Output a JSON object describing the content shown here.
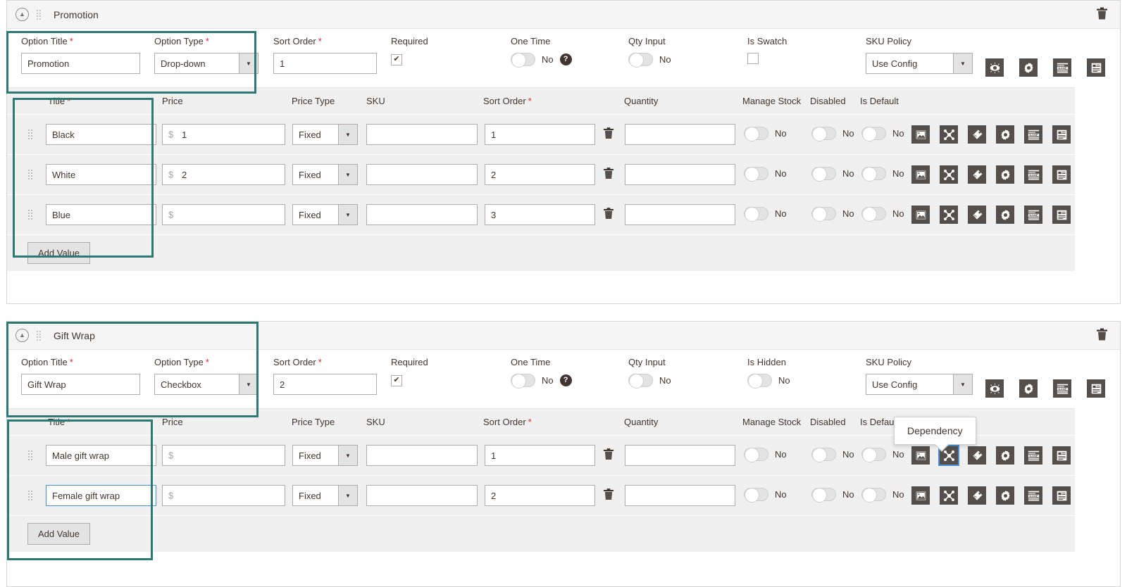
{
  "options": [
    {
      "header": {
        "title": "Promotion",
        "collapse_icon": "chevron-up-circle-icon",
        "drag_icon": "drag-handle-icon",
        "delete_icon": "trash-icon"
      },
      "meta": {
        "option_title_label": "Option Title",
        "option_title_value": "Promotion",
        "option_type_label": "Option Type",
        "option_type_value": "Drop-down",
        "sort_order_label": "Sort Order",
        "sort_order_value": "1",
        "required_label": "Required",
        "required_checked": "✔",
        "one_time_label": "One Time",
        "one_time_value": "No",
        "one_time_help_icon": "help-icon",
        "qty_input_label": "Qty Input",
        "qty_input_value": "No",
        "third_toggle_label": "Is Swatch",
        "third_toggle_kind": "checkbox",
        "third_toggle_value": "",
        "sku_policy_label": "SKU Policy",
        "sku_policy_value": "Use Config",
        "action_icons": [
          "preview-icon",
          "gear-icon",
          "name-icon",
          "list-icon"
        ]
      },
      "table": {
        "columns": [
          "Title",
          "Price",
          "Price Type",
          "SKU",
          "Sort Order",
          "Quantity",
          "Manage Stock",
          "Disabled",
          "Is Default"
        ],
        "title_required": true,
        "sort_order_required": true,
        "add_value_label": "Add Value",
        "rows": [
          {
            "title": "Black",
            "price": "1",
            "price_currency": "$",
            "price_type": "Fixed",
            "sku": "",
            "sort_order": "1",
            "quantity": "",
            "manage_stock": "No",
            "disabled": "No",
            "is_default": "No",
            "row_icons": [
              "image-icon",
              "dependency-icon",
              "price-tag-icon",
              "gear-icon",
              "name-icon",
              "list-icon"
            ]
          },
          {
            "title": "White",
            "price": "2",
            "price_currency": "$",
            "price_type": "Fixed",
            "sku": "",
            "sort_order": "2",
            "quantity": "",
            "manage_stock": "No",
            "disabled": "No",
            "is_default": "No",
            "row_icons": [
              "image-icon",
              "dependency-icon",
              "price-tag-icon",
              "gear-icon",
              "name-icon",
              "list-icon"
            ]
          },
          {
            "title": "Blue",
            "price": "",
            "price_currency": "$",
            "price_type": "Fixed",
            "sku": "",
            "sort_order": "3",
            "quantity": "",
            "manage_stock": "No",
            "disabled": "No",
            "is_default": "No",
            "row_icons": [
              "image-icon",
              "dependency-icon",
              "price-tag-icon",
              "gear-icon",
              "name-icon",
              "list-icon"
            ]
          }
        ]
      }
    },
    {
      "header": {
        "title": "Gift Wrap",
        "collapse_icon": "chevron-up-circle-icon",
        "drag_icon": "drag-handle-icon",
        "delete_icon": "trash-icon"
      },
      "meta": {
        "option_title_label": "Option Title",
        "option_title_value": "Gift Wrap",
        "option_type_label": "Option Type",
        "option_type_value": "Checkbox",
        "sort_order_label": "Sort Order",
        "sort_order_value": "2",
        "required_label": "Required",
        "required_checked": "✔",
        "one_time_label": "One Time",
        "one_time_value": "No",
        "one_time_help_icon": "help-icon",
        "qty_input_label": "Qty Input",
        "qty_input_value": "No",
        "third_toggle_label": "Is Hidden",
        "third_toggle_kind": "toggle",
        "third_toggle_value": "No",
        "sku_policy_label": "SKU Policy",
        "sku_policy_value": "Use Config",
        "action_icons": [
          "preview-icon",
          "gear-icon",
          "name-icon",
          "list-icon"
        ]
      },
      "table": {
        "columns": [
          "Title",
          "Price",
          "Price Type",
          "SKU",
          "Sort Order",
          "Quantity",
          "Manage Stock",
          "Disabled",
          "Is Default"
        ],
        "title_required": true,
        "sort_order_required": true,
        "add_value_label": "Add Value",
        "rows": [
          {
            "title": "Male gift wrap",
            "price": "",
            "price_currency": "$",
            "price_type": "Fixed",
            "sku": "",
            "sort_order": "1",
            "quantity": "",
            "manage_stock": "No",
            "disabled": "No",
            "is_default": "No",
            "row_icons": [
              "image-icon",
              "dependency-icon",
              "price-tag-icon",
              "gear-icon",
              "name-icon",
              "list-icon"
            ]
          },
          {
            "title": "Female gift wrap",
            "price": "",
            "price_currency": "$",
            "price_type": "Fixed",
            "sku": "",
            "sort_order": "2",
            "quantity": "",
            "manage_stock": "No",
            "disabled": "No",
            "is_default": "No",
            "row_icons": [
              "image-icon",
              "dependency-icon",
              "price-tag-icon",
              "gear-icon",
              "name-icon",
              "list-icon"
            ]
          }
        ]
      }
    }
  ],
  "tooltip": {
    "text": "Dependency"
  },
  "colors": {
    "highlight_border": "#2c7873",
    "required_star": "#e22626",
    "icon_button_bg": "#554f4b",
    "focus_blue": "#4a90d9",
    "row_bg": "#f0f0f0",
    "header_bg": "#f5f5f5"
  }
}
